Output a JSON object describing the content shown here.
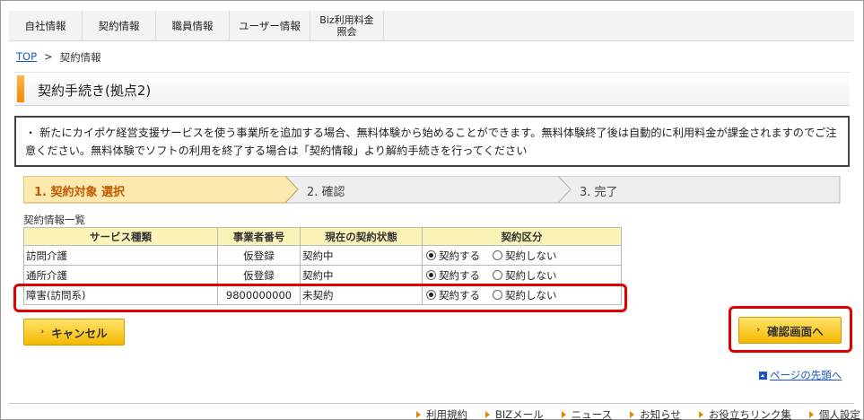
{
  "nav": {
    "items": [
      {
        "label": "自社情報"
      },
      {
        "label": "契約情報"
      },
      {
        "label": "職員情報"
      },
      {
        "label": "ユーザー情報"
      },
      {
        "label": "Biz利用料金\n照会"
      }
    ]
  },
  "breadcrumb": {
    "top": "TOP",
    "sep": ">",
    "current": "契約情報"
  },
  "page": {
    "title": "契約手続き(拠点2)"
  },
  "notice": {
    "bullet": "・",
    "text": "新たにカイポケ経営支援サービスを使う事業所を追加する場合、無料体験から始めることができます。無料体験終了後は自動的に利用料金が課金されますのでご注意ください。無料体験でソフトの利用を終了する場合は「契約情報」より解約手続きを行ってください"
  },
  "steps": {
    "step1": "1. 契約対象 選択",
    "step2": "2. 確認",
    "step3": "3. 完了",
    "active_color": "#fce9b0",
    "inactive_color": "#eeeeee"
  },
  "table": {
    "caption": "契約情報一覧",
    "headers": [
      "サービス種類",
      "事業者番号",
      "現在の契約状態",
      "契約区分"
    ],
    "option_yes": "契約する",
    "option_no": "契約しない",
    "rows": [
      {
        "service": "訪問介護",
        "number": "仮登録",
        "status": "契約中",
        "selected": "yes"
      },
      {
        "service": "通所介護",
        "number": "仮登録",
        "status": "契約中",
        "selected": "yes"
      },
      {
        "service": "障害(訪問系)",
        "number": "9800000000",
        "status": "未契約",
        "selected": "yes"
      }
    ]
  },
  "buttons": {
    "cancel": "キャンセル",
    "confirm": "確認画面へ"
  },
  "links": {
    "page_top": "ページの先頭へ"
  },
  "footer": {
    "items": [
      "利用規約",
      "BIZメール",
      "ニュース",
      "お知らせ",
      "お役立ちリンク集",
      "個人設定"
    ]
  },
  "colors": {
    "highlight": "#e00000",
    "button": "#f6b800",
    "link": "#1a55c4",
    "table_header": "#fcf3b9"
  }
}
